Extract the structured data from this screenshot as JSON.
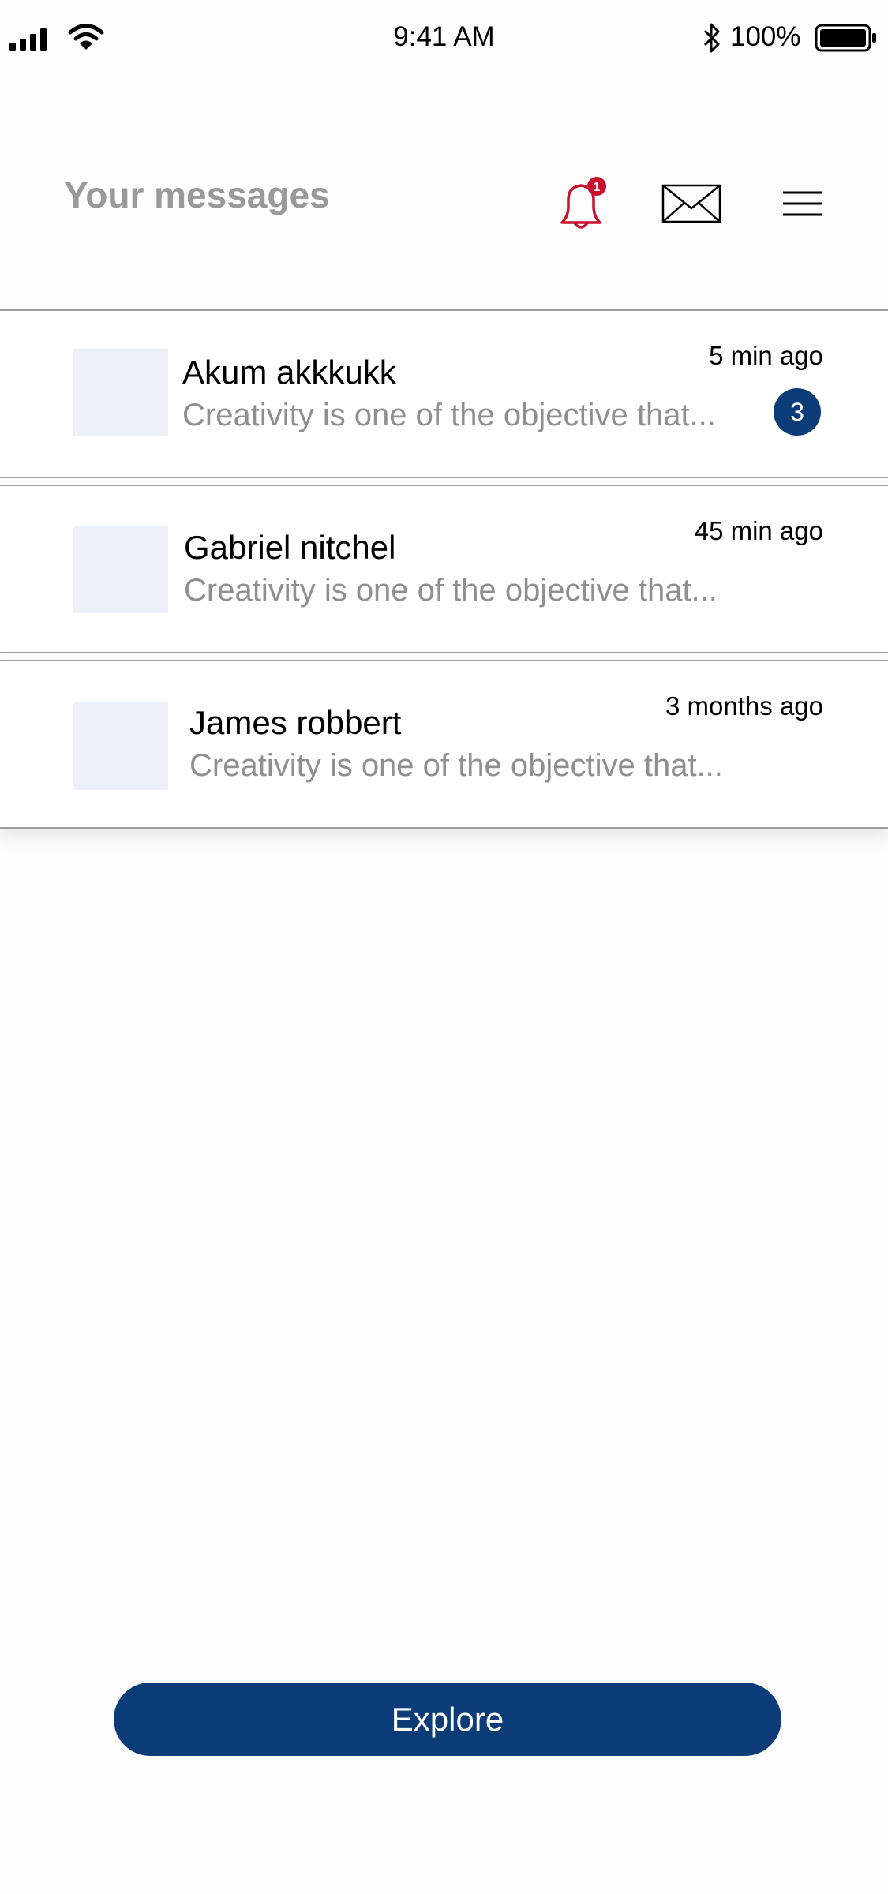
{
  "status_bar": {
    "time": "9:41 AM",
    "battery_percent": "100%",
    "icons": [
      "signal-icon",
      "wifi-icon",
      "bluetooth-icon",
      "battery-icon"
    ]
  },
  "header": {
    "title": "Your messages",
    "notification_count": "1",
    "icons": [
      "bell-icon",
      "mail-icon",
      "hamburger-menu-icon"
    ]
  },
  "messages": [
    {
      "name": "Akum akkkukk",
      "preview": "Creativity is one of the objective that...",
      "time": "5 min ago",
      "unread": "3"
    },
    {
      "name": "Gabriel nitchel",
      "preview": "Creativity is one of the objective that...",
      "time": "45 min ago"
    },
    {
      "name": "James robbert",
      "preview": "Creativity is one of the objective that...",
      "time": "3 months ago"
    }
  ],
  "explore_label": "Explore",
  "colors": {
    "primary": "#0b3c78",
    "notification": "#c8102e",
    "title_gray": "#999999",
    "preview_gray": "#8f8f8f",
    "avatar_placeholder": "#ebf0fb"
  }
}
